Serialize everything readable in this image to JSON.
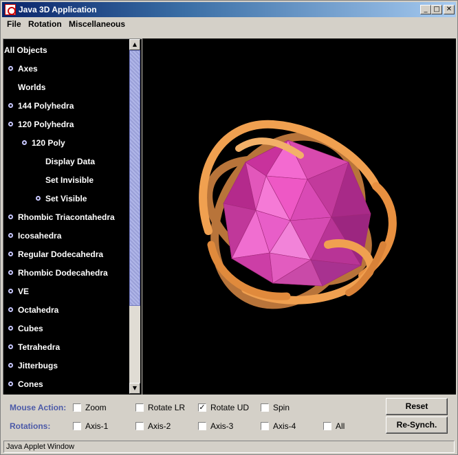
{
  "window": {
    "title": "Java 3D Application",
    "minimize": "_",
    "maximize": "□",
    "close": "✕"
  },
  "menu": [
    "File",
    "Rotation",
    "Miscellaneous"
  ],
  "tree": {
    "root": "All Objects",
    "items": [
      {
        "label": "Axes",
        "level": 1,
        "bullet": true
      },
      {
        "label": "Worlds",
        "level": 1,
        "bullet": false
      },
      {
        "label": "144 Polyhedra",
        "level": 1,
        "bullet": true
      },
      {
        "label": "120 Polyhedra",
        "level": 1,
        "bullet": true
      },
      {
        "label": "120 Poly",
        "level": 2,
        "bullet": true
      },
      {
        "label": "Display Data",
        "level": 3,
        "bullet": false
      },
      {
        "label": "Set Invisible",
        "level": 3,
        "bullet": false
      },
      {
        "label": "Set Visible",
        "level": 3,
        "bullet": true
      },
      {
        "label": "Rhombic Triacontahedra",
        "level": 1,
        "bullet": true
      },
      {
        "label": "Icosahedra",
        "level": 1,
        "bullet": true
      },
      {
        "label": "Regular Dodecahedra",
        "level": 1,
        "bullet": true
      },
      {
        "label": "Rhombic Dodecahedra",
        "level": 1,
        "bullet": true
      },
      {
        "label": "VE",
        "level": 1,
        "bullet": true
      },
      {
        "label": "Octahedra",
        "level": 1,
        "bullet": true
      },
      {
        "label": "Cubes",
        "level": 1,
        "bullet": true
      },
      {
        "label": "Tetrahedra",
        "level": 1,
        "bullet": true
      },
      {
        "label": "Jitterbugs",
        "level": 1,
        "bullet": true
      },
      {
        "label": "Cones",
        "level": 1,
        "bullet": true
      }
    ]
  },
  "scrollbar": {
    "up": "▲",
    "down": "▼"
  },
  "controls": {
    "mouse_action_label": "Mouse Action:",
    "rotations_label": "Rotations:",
    "mouse_actions": [
      {
        "label": "Zoom",
        "checked": false,
        "mark": ""
      },
      {
        "label": "Rotate LR",
        "checked": false,
        "mark": ""
      },
      {
        "label": "Rotate UD",
        "checked": true,
        "mark": "✓"
      },
      {
        "label": "Spin",
        "checked": false,
        "mark": ""
      }
    ],
    "rotations": [
      {
        "label": "Axis-1",
        "checked": false,
        "mark": ""
      },
      {
        "label": "Axis-2",
        "checked": false,
        "mark": ""
      },
      {
        "label": "Axis-3",
        "checked": false,
        "mark": ""
      },
      {
        "label": "Axis-4",
        "checked": false,
        "mark": ""
      },
      {
        "label": "All",
        "checked": false,
        "mark": ""
      }
    ],
    "reset_label": "Reset",
    "resynch_label": "Re-Synch."
  },
  "status": "Java Applet Window",
  "colors": {
    "polyhedron": "#e040b0",
    "rings": "#f0a050",
    "label_blue": "#4c5aa8"
  }
}
